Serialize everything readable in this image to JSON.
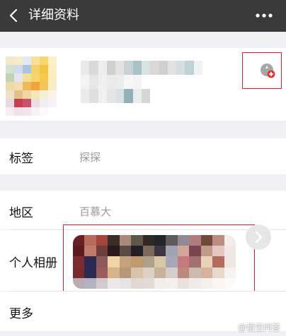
{
  "header": {
    "title": "详细资料",
    "bg_color": "#3a3a3a"
  },
  "icons": {
    "back": "chevron-left-icon",
    "more": "more-dots-icon",
    "add_friend": "add-friend-icon",
    "chevron": "chevron-right-icon"
  },
  "rows": {
    "tags": {
      "label": "标签",
      "value": "探探"
    },
    "region": {
      "label": "地区",
      "value": "百慕大"
    },
    "album": {
      "label": "个人相册"
    },
    "more": {
      "label": "更多"
    }
  },
  "watermark": "@悟空问答",
  "accent_color": "#d4202a"
}
